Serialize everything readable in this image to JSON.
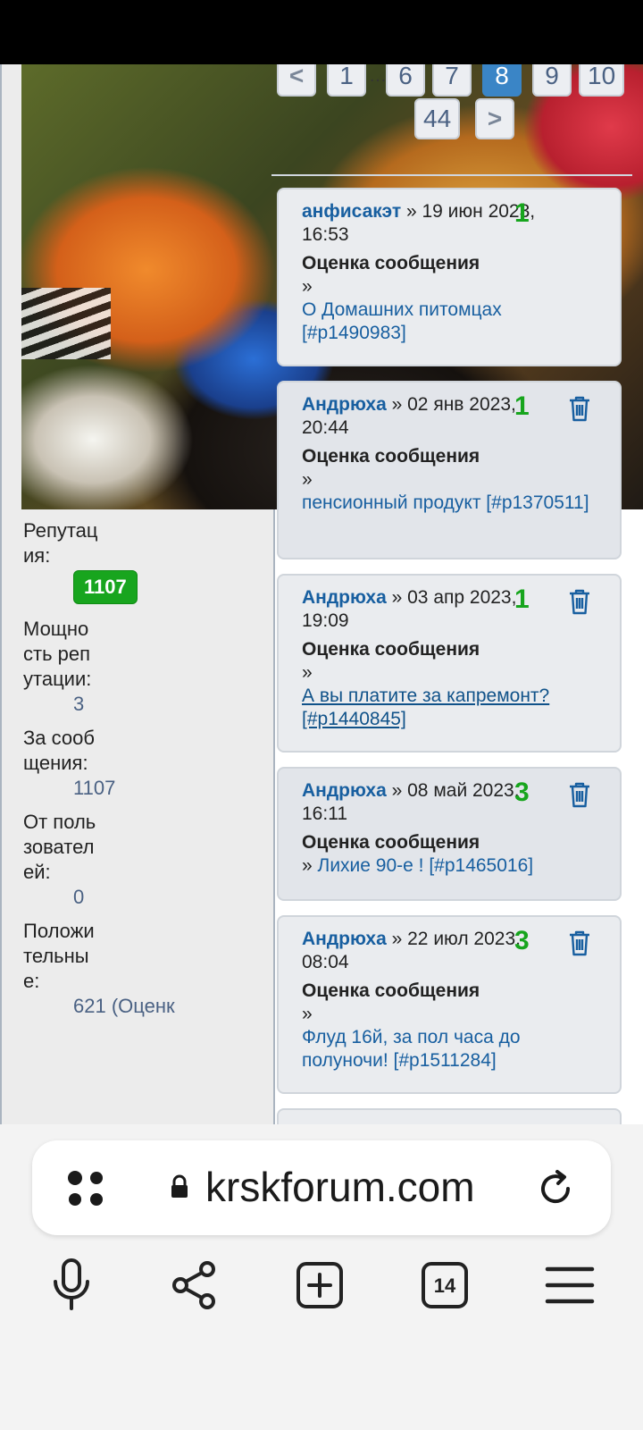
{
  "pager": {
    "prev": "<",
    "pages": [
      "1",
      "…",
      "6",
      "7",
      "8",
      "9",
      "10"
    ],
    "active": "8",
    "last": "44",
    "next": ">"
  },
  "profile": {
    "reputation_label": "Репутация:",
    "reputation_value": "1107",
    "power_label": "Мощность репутации:",
    "power_value": "3",
    "for_posts_label": "За сообщения:",
    "for_posts_value": "1107",
    "from_users_label": "От пользователей:",
    "from_users_value": "0",
    "positive_label": "Положительные:",
    "positive_value": "621 (Оценк"
  },
  "notices": [
    {
      "user": "анфисакэт",
      "date": " » 19 июн 2023, 16:53",
      "points": "1",
      "title": "Оценка сообщения",
      "prefix": "»",
      "link": "О Домашних питомцах [#p1490983]",
      "deletable": false
    },
    {
      "user": "Андрюха",
      "date": " » 02 янв 2023, 20:44",
      "points": "1",
      "title": "Оценка сообщения",
      "prefix": "»",
      "link": "пенсионный продукт [#p1370511]",
      "deletable": true
    },
    {
      "user": "Андрюха",
      "date": " » 03 апр 2023, 19:09",
      "points": "1",
      "title": "Оценка сообщения",
      "prefix": "»",
      "link": "А вы платите за капремонт? [#p1440845]",
      "deletable": true
    },
    {
      "user": "Андрюха",
      "date": " » 08 май 2023, 16:11",
      "points": "3",
      "title": "Оценка сообщения",
      "prefix": "»",
      "link": "Лихие 90-е ! [#p1465016]",
      "deletable": true
    },
    {
      "user": "Андрюха",
      "date": " » 22 июл 2023, 08:04",
      "points": "3",
      "title": "Оценка сообщения",
      "prefix": "»",
      "link": "Флуд 16й, за пол часа до полуночи! [#p1511284]",
      "deletable": true
    }
  ],
  "browser": {
    "url": "krskforum.com",
    "tab_count": "14"
  },
  "colors": {
    "link": "#185fa0",
    "points": "#17a51d",
    "badge": "#18a51e",
    "active_page": "#3a85c6"
  }
}
